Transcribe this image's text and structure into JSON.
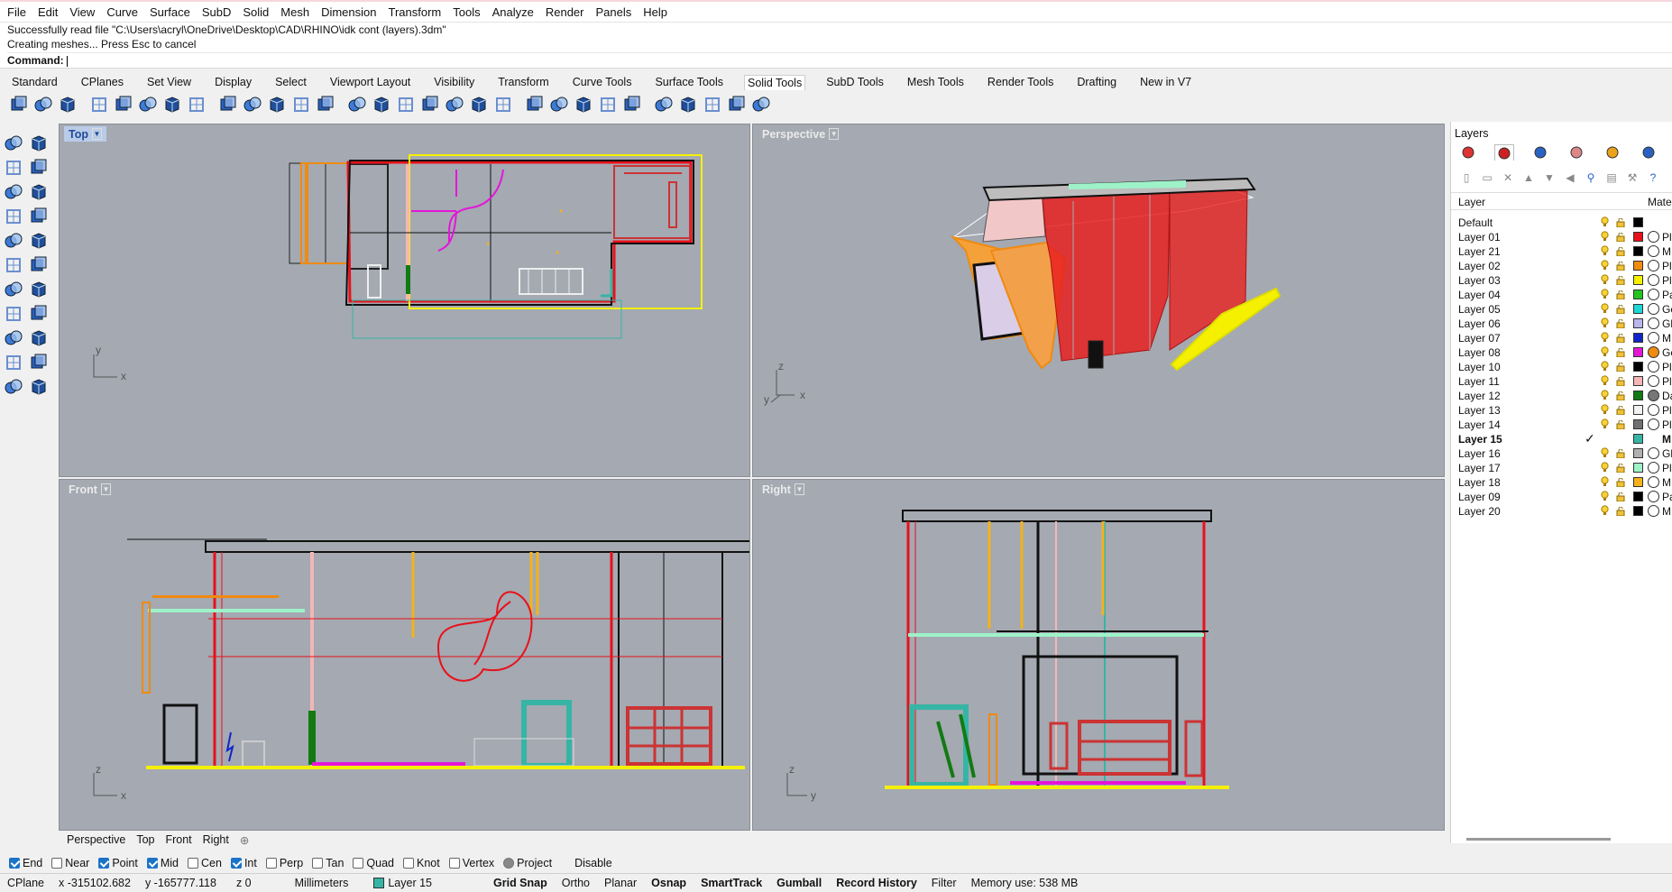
{
  "menu": [
    "File",
    "Edit",
    "View",
    "Curve",
    "Surface",
    "SubD",
    "Solid",
    "Mesh",
    "Dimension",
    "Transform",
    "Tools",
    "Analyze",
    "Render",
    "Panels",
    "Help"
  ],
  "command": {
    "line1": "Successfully read file \"C:\\Users\\acryl\\OneDrive\\Desktop\\CAD\\RHINO\\idk cont (layers).3dm\"",
    "line2": "Creating meshes... Press Esc to cancel",
    "prompt": "Command:"
  },
  "toolbar_tabs": [
    "Standard",
    "CPlanes",
    "Set View",
    "Display",
    "Select",
    "Viewport Layout",
    "Visibility",
    "Transform",
    "Curve Tools",
    "Surface Tools",
    "Solid Tools",
    "SubD Tools",
    "Mesh Tools",
    "Render Tools",
    "Drafting",
    "New in V7"
  ],
  "active_toolbar_tab": "Solid Tools",
  "solid_tool_icons": [
    "boolean-union-icon",
    "boolean-difference-icon",
    "boolean-intersection-icon",
    "boolean-split-icon",
    "box-icon",
    "box-edge-icon",
    "solid-extrude-icon",
    "slab-icon",
    "cube-icon",
    "array-icon",
    "cap-icon",
    "box-solid-icon",
    "box-solid-2-icon",
    "wirecut-icon",
    "extrude-face-icon",
    "move-edge-icon",
    "move-face-icon",
    "split-face-icon",
    "fillet-edge-icon",
    "chamfer-edge-icon",
    "blend-edge-icon",
    "offset-icon",
    "shell-icon",
    "merge-face-icon",
    "solid-points-icon",
    "rebuild-icon",
    "mesh-grid-icon",
    "mesh-grid-2-icon",
    "delete-face-icon",
    "trash-icon"
  ],
  "left_tool_icons": [
    "select-arrow-icon",
    "point-icon",
    "line-icon",
    "polyline-icon",
    "curve-icon",
    "rectangle-icon",
    "circle-icon",
    "arc-icon",
    "ellipse-icon",
    "polygon-icon",
    "surface-icon",
    "extrude-icon",
    "cone-icon",
    "pyramid-icon",
    "cylinder-icon",
    "tube-icon",
    "torus-icon",
    "sphere-icon",
    "boolean-icon",
    "revolve-icon",
    "layer-icon",
    "mesh-icon"
  ],
  "viewports": {
    "top": {
      "label": "Top",
      "axis_a": "y",
      "axis_b": "x"
    },
    "perspective": {
      "label": "Perspective",
      "axis_z": "z",
      "axis_y": "y",
      "axis_x": "x"
    },
    "front": {
      "label": "Front",
      "axis_a": "z",
      "axis_b": "x"
    },
    "right": {
      "label": "Right",
      "axis_a": "z",
      "axis_b": "y"
    }
  },
  "viewport_tabs": [
    "Perspective",
    "Top",
    "Front",
    "Right"
  ],
  "osnap": [
    {
      "label": "End",
      "checked": true
    },
    {
      "label": "Near",
      "checked": false
    },
    {
      "label": "Point",
      "checked": true
    },
    {
      "label": "Mid",
      "checked": true
    },
    {
      "label": "Cen",
      "checked": false
    },
    {
      "label": "Int",
      "checked": true
    },
    {
      "label": "Perp",
      "checked": false
    },
    {
      "label": "Tan",
      "checked": false
    },
    {
      "label": "Quad",
      "checked": false
    },
    {
      "label": "Knot",
      "checked": false
    },
    {
      "label": "Vertex",
      "checked": false
    },
    {
      "label": "Project",
      "checked": false
    },
    {
      "label": "Disable",
      "checked": false
    }
  ],
  "status": {
    "cplane": "CPlane",
    "x": "x -315102.682",
    "y": "y -165777.118",
    "z": "z 0",
    "units": "Millimeters",
    "layer": "Layer 15",
    "grid_snap": "Grid Snap",
    "ortho": "Ortho",
    "planar": "Planar",
    "osnap": "Osnap",
    "smarttrack": "SmartTrack",
    "gumball": "Gumball",
    "record_history": "Record History",
    "filter": "Filter",
    "memory": "Memory use: 538 MB"
  },
  "layers_panel": {
    "title": "Layers",
    "col_layer": "Layer",
    "col_material": "Mate",
    "tab_icons": [
      "color-wheel-icon",
      "layers-icon",
      "render-icon",
      "paint-icon",
      "folder-icon",
      "display-icon"
    ],
    "tool_icons": [
      "new-layer-icon",
      "new-sublayer-icon",
      "delete-icon",
      "move-up-icon",
      "move-down-icon",
      "move-parent-icon",
      "filter-icon",
      "page-icon",
      "tools-icon",
      "help-icon"
    ],
    "current_layer": "Layer 15",
    "rows": [
      {
        "name": "Default",
        "color": "#000000",
        "material": "",
        "mat_color": ""
      },
      {
        "name": "Layer 01",
        "color": "#e8111a",
        "material": "Pl",
        "mat_color": "#ffffff"
      },
      {
        "name": "Layer 21",
        "color": "#000000",
        "material": "M",
        "mat_color": "#ffffff"
      },
      {
        "name": "Layer 02",
        "color": "#f08a10",
        "material": "Pl",
        "mat_color": "#ffffff"
      },
      {
        "name": "Layer 03",
        "color": "#f5f000",
        "material": "Pl",
        "mat_color": "#ffffff"
      },
      {
        "name": "Layer 04",
        "color": "#22c41e",
        "material": "Pa",
        "mat_color": "#ffffff"
      },
      {
        "name": "Layer 05",
        "color": "#1fd6d6",
        "material": "Ge",
        "mat_color": "#ffffff"
      },
      {
        "name": "Layer 06",
        "color": "#b9b6ec",
        "material": "Gl",
        "mat_color": "#ffffff"
      },
      {
        "name": "Layer 07",
        "color": "#1025c8",
        "material": "M",
        "mat_color": "#ffffff"
      },
      {
        "name": "Layer 08",
        "color": "#e416d8",
        "material": "Ge",
        "mat_color": "#f08a10"
      },
      {
        "name": "Layer 10",
        "color": "#000000",
        "material": "Pl",
        "mat_color": "#ffffff"
      },
      {
        "name": "Layer 11",
        "color": "#f4b6b6",
        "material": "Pl",
        "mat_color": "#ffffff"
      },
      {
        "name": "Layer 12",
        "color": "#127a12",
        "material": "Da",
        "mat_color": "#777777"
      },
      {
        "name": "Layer 13",
        "color": "#f2f2f2",
        "material": "Pl",
        "mat_color": "#ffffff"
      },
      {
        "name": "Layer 14",
        "color": "#707070",
        "material": "Pl",
        "mat_color": "#ffffff"
      },
      {
        "name": "Layer 15",
        "color": "#36b5a5",
        "material": "M",
        "mat_color": ""
      },
      {
        "name": "Layer 16",
        "color": "#b0b0b0",
        "material": "Gl",
        "mat_color": "#ffffff"
      },
      {
        "name": "Layer 17",
        "color": "#9ef2c8",
        "material": "Pl",
        "mat_color": "#ffffff"
      },
      {
        "name": "Layer 18",
        "color": "#f5b21a",
        "material": "M",
        "mat_color": "#ffffff"
      },
      {
        "name": "Layer 09",
        "color": "#000000",
        "material": "Pa",
        "mat_color": "#ffffff"
      },
      {
        "name": "Layer 20",
        "color": "#000000",
        "material": "M",
        "mat_color": "#ffffff"
      }
    ]
  }
}
